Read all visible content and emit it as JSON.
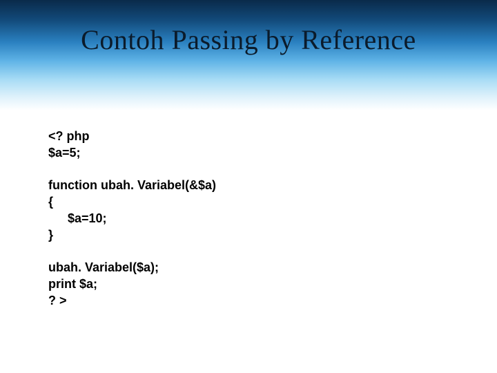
{
  "title": "Contoh Passing by Reference",
  "code": {
    "l1": "<? php",
    "l2": "$a=5;",
    "l3": "function ubah. Variabel(&$a)",
    "l4": "{",
    "l5": "$a=10;",
    "l6": "}",
    "l7": "ubah. Variabel($a);",
    "l8": "print $a;",
    "l9": "? >"
  }
}
